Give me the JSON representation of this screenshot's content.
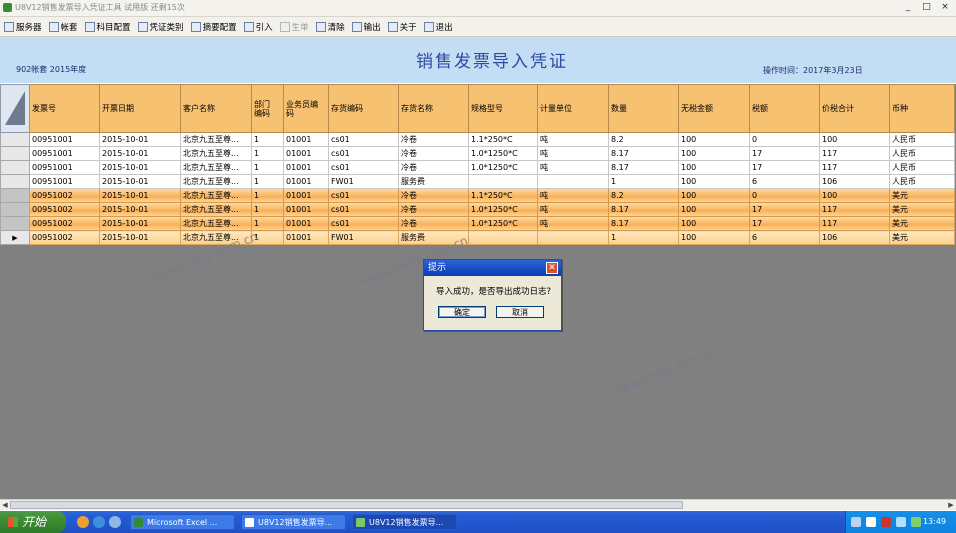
{
  "window": {
    "title": "U8V12销售发票导入凭证工具  试用版  还剩15次",
    "controls": [
      "_",
      "□",
      "×"
    ]
  },
  "toolbar": {
    "items": [
      {
        "label": "服务器",
        "icon": "server-icon",
        "enabled": true
      },
      {
        "label": "帐套",
        "icon": "account-set-icon",
        "enabled": true
      },
      {
        "label": "科目配置",
        "icon": "subject-config-icon",
        "enabled": true
      },
      {
        "label": "凭证类别",
        "icon": "voucher-type-icon",
        "enabled": true
      },
      {
        "label": "摘要配置",
        "icon": "summary-config-icon",
        "enabled": true
      },
      {
        "label": "引入",
        "icon": "import-icon",
        "enabled": true
      },
      {
        "label": "生单",
        "icon": "generate-icon",
        "enabled": false
      },
      {
        "label": "清除",
        "icon": "clear-icon",
        "enabled": true
      },
      {
        "label": "输出",
        "icon": "export-icon",
        "enabled": true
      },
      {
        "label": "关于",
        "icon": "info-icon",
        "enabled": true
      },
      {
        "label": "退出",
        "icon": "exit-icon",
        "enabled": true
      }
    ]
  },
  "header": {
    "account": "902帐套  2015年度",
    "title": "销售发票导入凭证",
    "op_time": "操作时间：2017年3月23日"
  },
  "grid": {
    "columns": [
      "发票号",
      "开票日期",
      "客户名称",
      "部门\n编码",
      "业务员编\n码",
      "存货编码",
      "存货名称",
      "规格型号",
      "计量单位",
      "数量",
      "无税金额",
      "税额",
      "价税合计",
      "币种"
    ],
    "rows": [
      {
        "style": "white",
        "marker": "",
        "cells": [
          "00951001",
          "2015-10-01",
          "北京九五至尊...",
          "1",
          "01001",
          "cs01",
          "冷卷",
          "1.1*250*C",
          "吨",
          "8.2",
          "100",
          "0",
          "100",
          "人民币"
        ]
      },
      {
        "style": "white",
        "marker": "",
        "cells": [
          "00951001",
          "2015-10-01",
          "北京九五至尊...",
          "1",
          "01001",
          "cs01",
          "冷卷",
          "1.0*1250*C",
          "吨",
          "8.17",
          "100",
          "17",
          "117",
          "人民币"
        ]
      },
      {
        "style": "white",
        "marker": "",
        "cells": [
          "00951001",
          "2015-10-01",
          "北京九五至尊...",
          "1",
          "01001",
          "cs01",
          "冷卷",
          "1.0*1250*C",
          "吨",
          "8.17",
          "100",
          "17",
          "117",
          "人民币"
        ]
      },
      {
        "style": "white",
        "marker": "",
        "cells": [
          "00951001",
          "2015-10-01",
          "北京九五至尊...",
          "1",
          "01001",
          "FW01",
          "服务费",
          "",
          "",
          "1",
          "100",
          "6",
          "106",
          "人民币"
        ]
      },
      {
        "style": "orange",
        "marker": "",
        "cells": [
          "00951002",
          "2015-10-01",
          "北京九五至尊...",
          "1",
          "01001",
          "cs01",
          "冷卷",
          "1.1*250*C",
          "吨",
          "8.2",
          "100",
          "0",
          "100",
          "美元"
        ]
      },
      {
        "style": "orange",
        "marker": "",
        "cells": [
          "00951002",
          "2015-10-01",
          "北京九五至尊...",
          "1",
          "01001",
          "cs01",
          "冷卷",
          "1.0*1250*C",
          "吨",
          "8.17",
          "100",
          "17",
          "117",
          "美元"
        ]
      },
      {
        "style": "orange",
        "marker": "",
        "cells": [
          "00951002",
          "2015-10-01",
          "北京九五至尊...",
          "1",
          "01001",
          "cs01",
          "冷卷",
          "1.0*1250*C",
          "吨",
          "8.17",
          "100",
          "17",
          "117",
          "美元"
        ]
      },
      {
        "style": "light",
        "marker": "▶",
        "cells": [
          "00951002",
          "2015-10-01",
          "北京九五至尊...",
          "1",
          "01001",
          "FW01",
          "服务费",
          "",
          "",
          "1",
          "100",
          "6",
          "106",
          "美元"
        ]
      }
    ]
  },
  "watermark": "www.soerp.com.cn",
  "dialog": {
    "title": "提示",
    "message": "导入成功，是否导出成功日志?",
    "ok": "确定",
    "cancel": "取消"
  },
  "taskbar": {
    "start": "开始",
    "tasks": [
      {
        "label": "Microsoft Excel ...",
        "icon": "excel-icon"
      },
      {
        "label": "U8V12销售发票导...",
        "icon": "window-icon"
      },
      {
        "label": "U8V12销售发票导...",
        "icon": "app-icon"
      }
    ],
    "clock": "13:49"
  }
}
